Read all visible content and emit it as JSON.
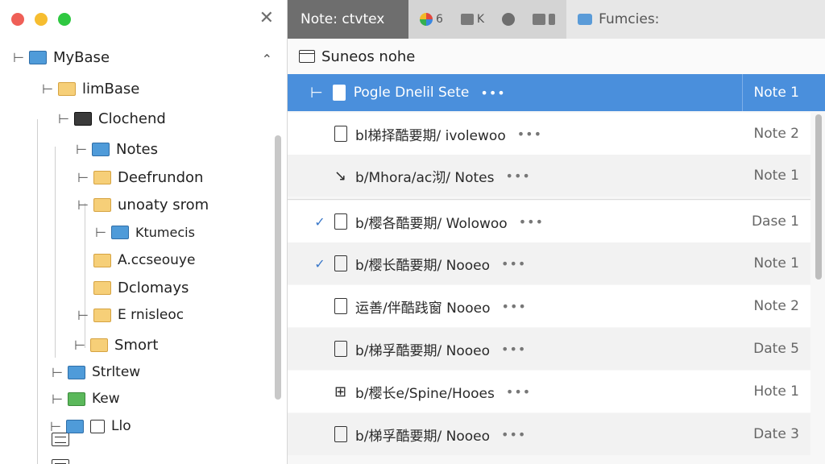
{
  "sidebar": {
    "items": [
      {
        "label": "MyBase",
        "icon": "folder-blue-icon",
        "color": "blue"
      },
      {
        "label": "limBase",
        "icon": "folder-yellow-icon",
        "color": "yellow"
      },
      {
        "label": "Clochend",
        "icon": "folder-dark-icon",
        "color": "dark"
      },
      {
        "label": "Notes",
        "icon": "folder-blue-icon",
        "color": "blue"
      },
      {
        "label": "Deefrundon",
        "icon": "folder-yellow-icon",
        "color": "yellow"
      },
      {
        "label": "unoaty srom",
        "icon": "folder-yellow-icon",
        "color": "yellow"
      },
      {
        "label": "Ktumecis",
        "icon": "folder-blue-icon",
        "color": "blue"
      },
      {
        "label": "A.ccseouye",
        "icon": "folder-yellow-icon",
        "color": "yellow"
      },
      {
        "label": "Dclomays",
        "icon": "folder-yellow-icon",
        "color": "yellow"
      },
      {
        "label": "E rnisleoc",
        "icon": "folder-yellow-icon",
        "color": "yellow"
      },
      {
        "label": "Smort",
        "icon": "folder-yellow-icon",
        "color": "yellow"
      },
      {
        "label": "Strltew",
        "icon": "list-icon",
        "color": "list"
      },
      {
        "label": "Kew",
        "icon": "list-icon",
        "color": "list"
      },
      {
        "label": "Llo",
        "icon": "document-icon",
        "color": "doc"
      }
    ]
  },
  "tabs": {
    "active_label": "Note: ctvtex",
    "icon_tab_1": "6",
    "icon_tab_2": "K",
    "func_label": "Fumcies:"
  },
  "subheader": {
    "title": "Suneos nohe"
  },
  "notes": [
    {
      "title": "Pogle Dnelil Sete",
      "tag": "Note 1",
      "selected": true
    },
    {
      "title": "bl梯择酷要期/ ivolewoo",
      "tag": "Note 2"
    },
    {
      "title": "b/Mhora/ac沏/ Notes",
      "tag": "Note 1"
    },
    {
      "title": "b/樱各酷要期/ Wolowoo",
      "tag": "Dase 1",
      "checked": true
    },
    {
      "title": "b/樱长酷要期/ Nooeo",
      "tag": "Note 1",
      "checked": true
    },
    {
      "title": "运善/伴酷践窗 Nooeo",
      "tag": "Note 2"
    },
    {
      "title": "b/梯孚酷要期/ Nooeo",
      "tag": "Date 5"
    },
    {
      "title": "b/樱长e/Spine/Hooes",
      "tag": "Hote 1"
    },
    {
      "title": "b/梯孚酷要期/ Nooeo",
      "tag": "Date 3"
    }
  ],
  "glyphs": {
    "dots": "•••",
    "close": "✕",
    "chevron": "⌃",
    "check": "✓",
    "branch": "⊢",
    "arrow": "↘",
    "grid": "⊞"
  },
  "colors": {
    "accent": "#4a8fdc",
    "tab_active": "#6e6e6e",
    "folder_blue": "#4f9bd9",
    "folder_yellow": "#f6cf78",
    "folder_green": "#5bb85b"
  }
}
